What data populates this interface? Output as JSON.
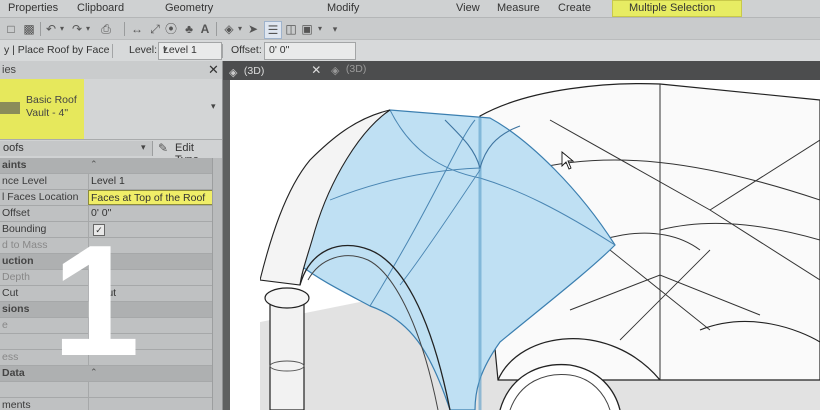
{
  "ribbon": {
    "panels": [
      "Properties",
      "Clipboard",
      "Geometry",
      "Modify",
      "View",
      "Measure",
      "Create",
      "Multiple Selection"
    ],
    "highlight_color": "#e6e85c"
  },
  "options_bar": {
    "context": "y | Place Roof by Face",
    "level_label": "Level:",
    "level_value": "Level 1",
    "offset_label": "Offset:",
    "offset_value": "0'  0\""
  },
  "properties": {
    "header": "ies",
    "type_name": "Basic Roof\nVault - 4\"",
    "filter_value": "oofs",
    "edit_type_label": "Edit Type",
    "rows": [
      {
        "key": "aints",
        "group": true
      },
      {
        "key": "nce Level",
        "value": "Level 1"
      },
      {
        "key": "l Faces Location",
        "value": "Faces at Top of the Roof",
        "highlight": true
      },
      {
        "key": "Offset",
        "value": "0'  0\""
      },
      {
        "key": "Bounding",
        "checkbox": true
      },
      {
        "key": "d to Mass",
        "value": ""
      },
      {
        "key": "uction",
        "group": true
      },
      {
        "key": "Depth",
        "value": ""
      },
      {
        "key": "Cut",
        "value": "b Cut"
      },
      {
        "key": "sions",
        "group": true
      },
      {
        "key": "e",
        "value": ""
      },
      {
        "key": "",
        "value": ""
      },
      {
        "key": "ess",
        "value": ""
      },
      {
        "key": "Data",
        "group": true
      },
      {
        "key": "",
        "value": ""
      },
      {
        "key": "ments",
        "value": ""
      }
    ]
  },
  "view_tabs": [
    {
      "label": "(3D)",
      "closable": true
    },
    {
      "label": "(3D)",
      "closable": false
    }
  ],
  "overlay": {
    "number": "1"
  }
}
